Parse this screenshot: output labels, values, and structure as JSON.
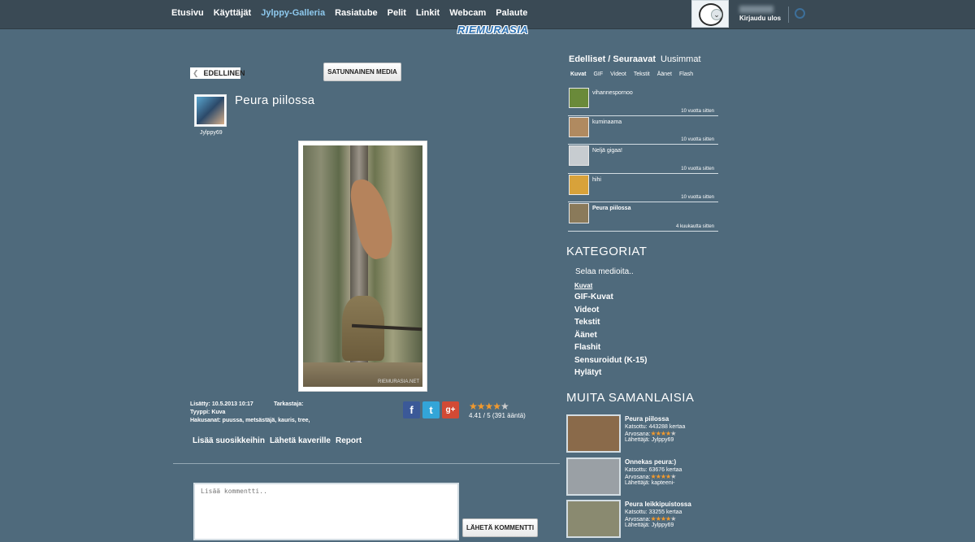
{
  "nav": {
    "items": [
      "Etusivu",
      "Käyttäjät",
      "Jylppy-Galleria",
      "Rasiatube",
      "Pelit",
      "Linkit",
      "Webcam",
      "Palaute"
    ],
    "active": "Jylppy-Galleria"
  },
  "logo": "RIEMURASIA",
  "user": {
    "logout_label": "Kirjaudu ulos"
  },
  "media": {
    "prev_label": "EDELLINEN",
    "random_label": "SATUNNAINEN MEDIA",
    "title": "Peura piilossa",
    "uploader": "Jylppy69",
    "watermark": "RIEMURASIA.NET",
    "added": "Lisätty: 10.5.2013 10:17",
    "checker": "Tarkastaja:",
    "type": "Tyyppi: Kuva",
    "tags": "Hakusanat: puussa, metsästäjä, kauris, tree,",
    "rating_text": "4.41 / 5 (391 ääntä)",
    "rating_value": 4.41,
    "actions": [
      "Lisää suosikkeihin",
      "Lähetä kaverille",
      "Report"
    ]
  },
  "comment": {
    "placeholder": "Lisää kommentti..",
    "send_label": "LÄHETÄ KOMMENTTI"
  },
  "sidebar": {
    "header_prev_next": "Edelliset / Seuraavat",
    "header_latest": "Uusimmat",
    "filters": [
      "Kuvat",
      "GIF",
      "Videot",
      "Tekstit",
      "Äänet",
      "Flash"
    ],
    "filter_selected": "Kuvat",
    "recent": [
      {
        "name": "vihannespornoo",
        "time": "10 vuotta sitten",
        "color": "#6a8a3a"
      },
      {
        "name": "kuminaama",
        "time": "10 vuotta sitten",
        "color": "#b08a60"
      },
      {
        "name": "Neljä gigaa!",
        "time": "10 vuotta sitten",
        "color": "#c7ccd0"
      },
      {
        "name": "hihi",
        "time": "10 vuotta sitten",
        "color": "#d8a23a"
      },
      {
        "name": "Peura piilossa",
        "time": "4 kuukautta sitten",
        "color": "#8a7a5a",
        "current": true
      }
    ],
    "categories_title": "KATEGORIAT",
    "browse_label": "Selaa medioita..",
    "categories": [
      "Kuvat",
      "GIF-Kuvat",
      "Videot",
      "Tekstit",
      "Äänet",
      "Flashit",
      "Sensuroidut (K-15)",
      "Hylätyt"
    ],
    "category_selected": "Kuvat",
    "similar_title": "MUITA SAMANLAISIA",
    "similar": [
      {
        "title": "Peura piilossa",
        "views": "Katsottu: 443288 kertaa",
        "rating_label": "Arvosana:",
        "sender": "Lähettäjä: Jylppy69",
        "color": "#8a6a4a"
      },
      {
        "title": "Onnekas peura:)",
        "views": "Katsottu: 63676 kertaa",
        "rating_label": "Arvosana:",
        "sender": "Lähettäjä: kapteeni-",
        "color": "#9aa0a5"
      },
      {
        "title": "Peura leikkipuistossa",
        "views": "Katsottu: 33255 kertaa",
        "rating_label": "Arvosana:",
        "sender": "Lähettäjä: Jylppy69",
        "color": "#8a8a70"
      }
    ]
  }
}
